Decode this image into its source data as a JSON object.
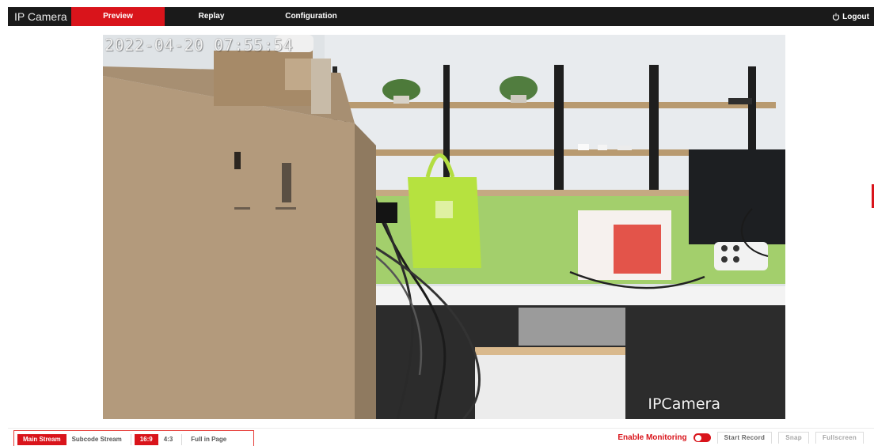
{
  "app": {
    "title": "IP Camera"
  },
  "nav": {
    "items": [
      {
        "label": "Preview",
        "active": true
      },
      {
        "label": "Replay",
        "active": false
      },
      {
        "label": "Configuration",
        "active": false
      }
    ],
    "logout_label": "Logout",
    "accent_color": "#d9141b"
  },
  "video": {
    "osd_timestamp": "2022-04-20 07:55:54",
    "osd_camera_name": "IPCamera"
  },
  "toolbar": {
    "stream_buttons": [
      {
        "label": "Main Stream",
        "selected": true
      },
      {
        "label": "Subcode Stream",
        "selected": false
      }
    ],
    "ratio_buttons": [
      {
        "label": "16:9",
        "selected": true
      },
      {
        "label": "4:3",
        "selected": false
      },
      {
        "label": "Full in Page",
        "selected": false
      }
    ],
    "monitoring_label": "Enable Monitoring",
    "monitoring_enabled": true,
    "start_record_label": "Start Record",
    "snap_label": "Snap",
    "fullscreen_label": "Fullscreen"
  }
}
